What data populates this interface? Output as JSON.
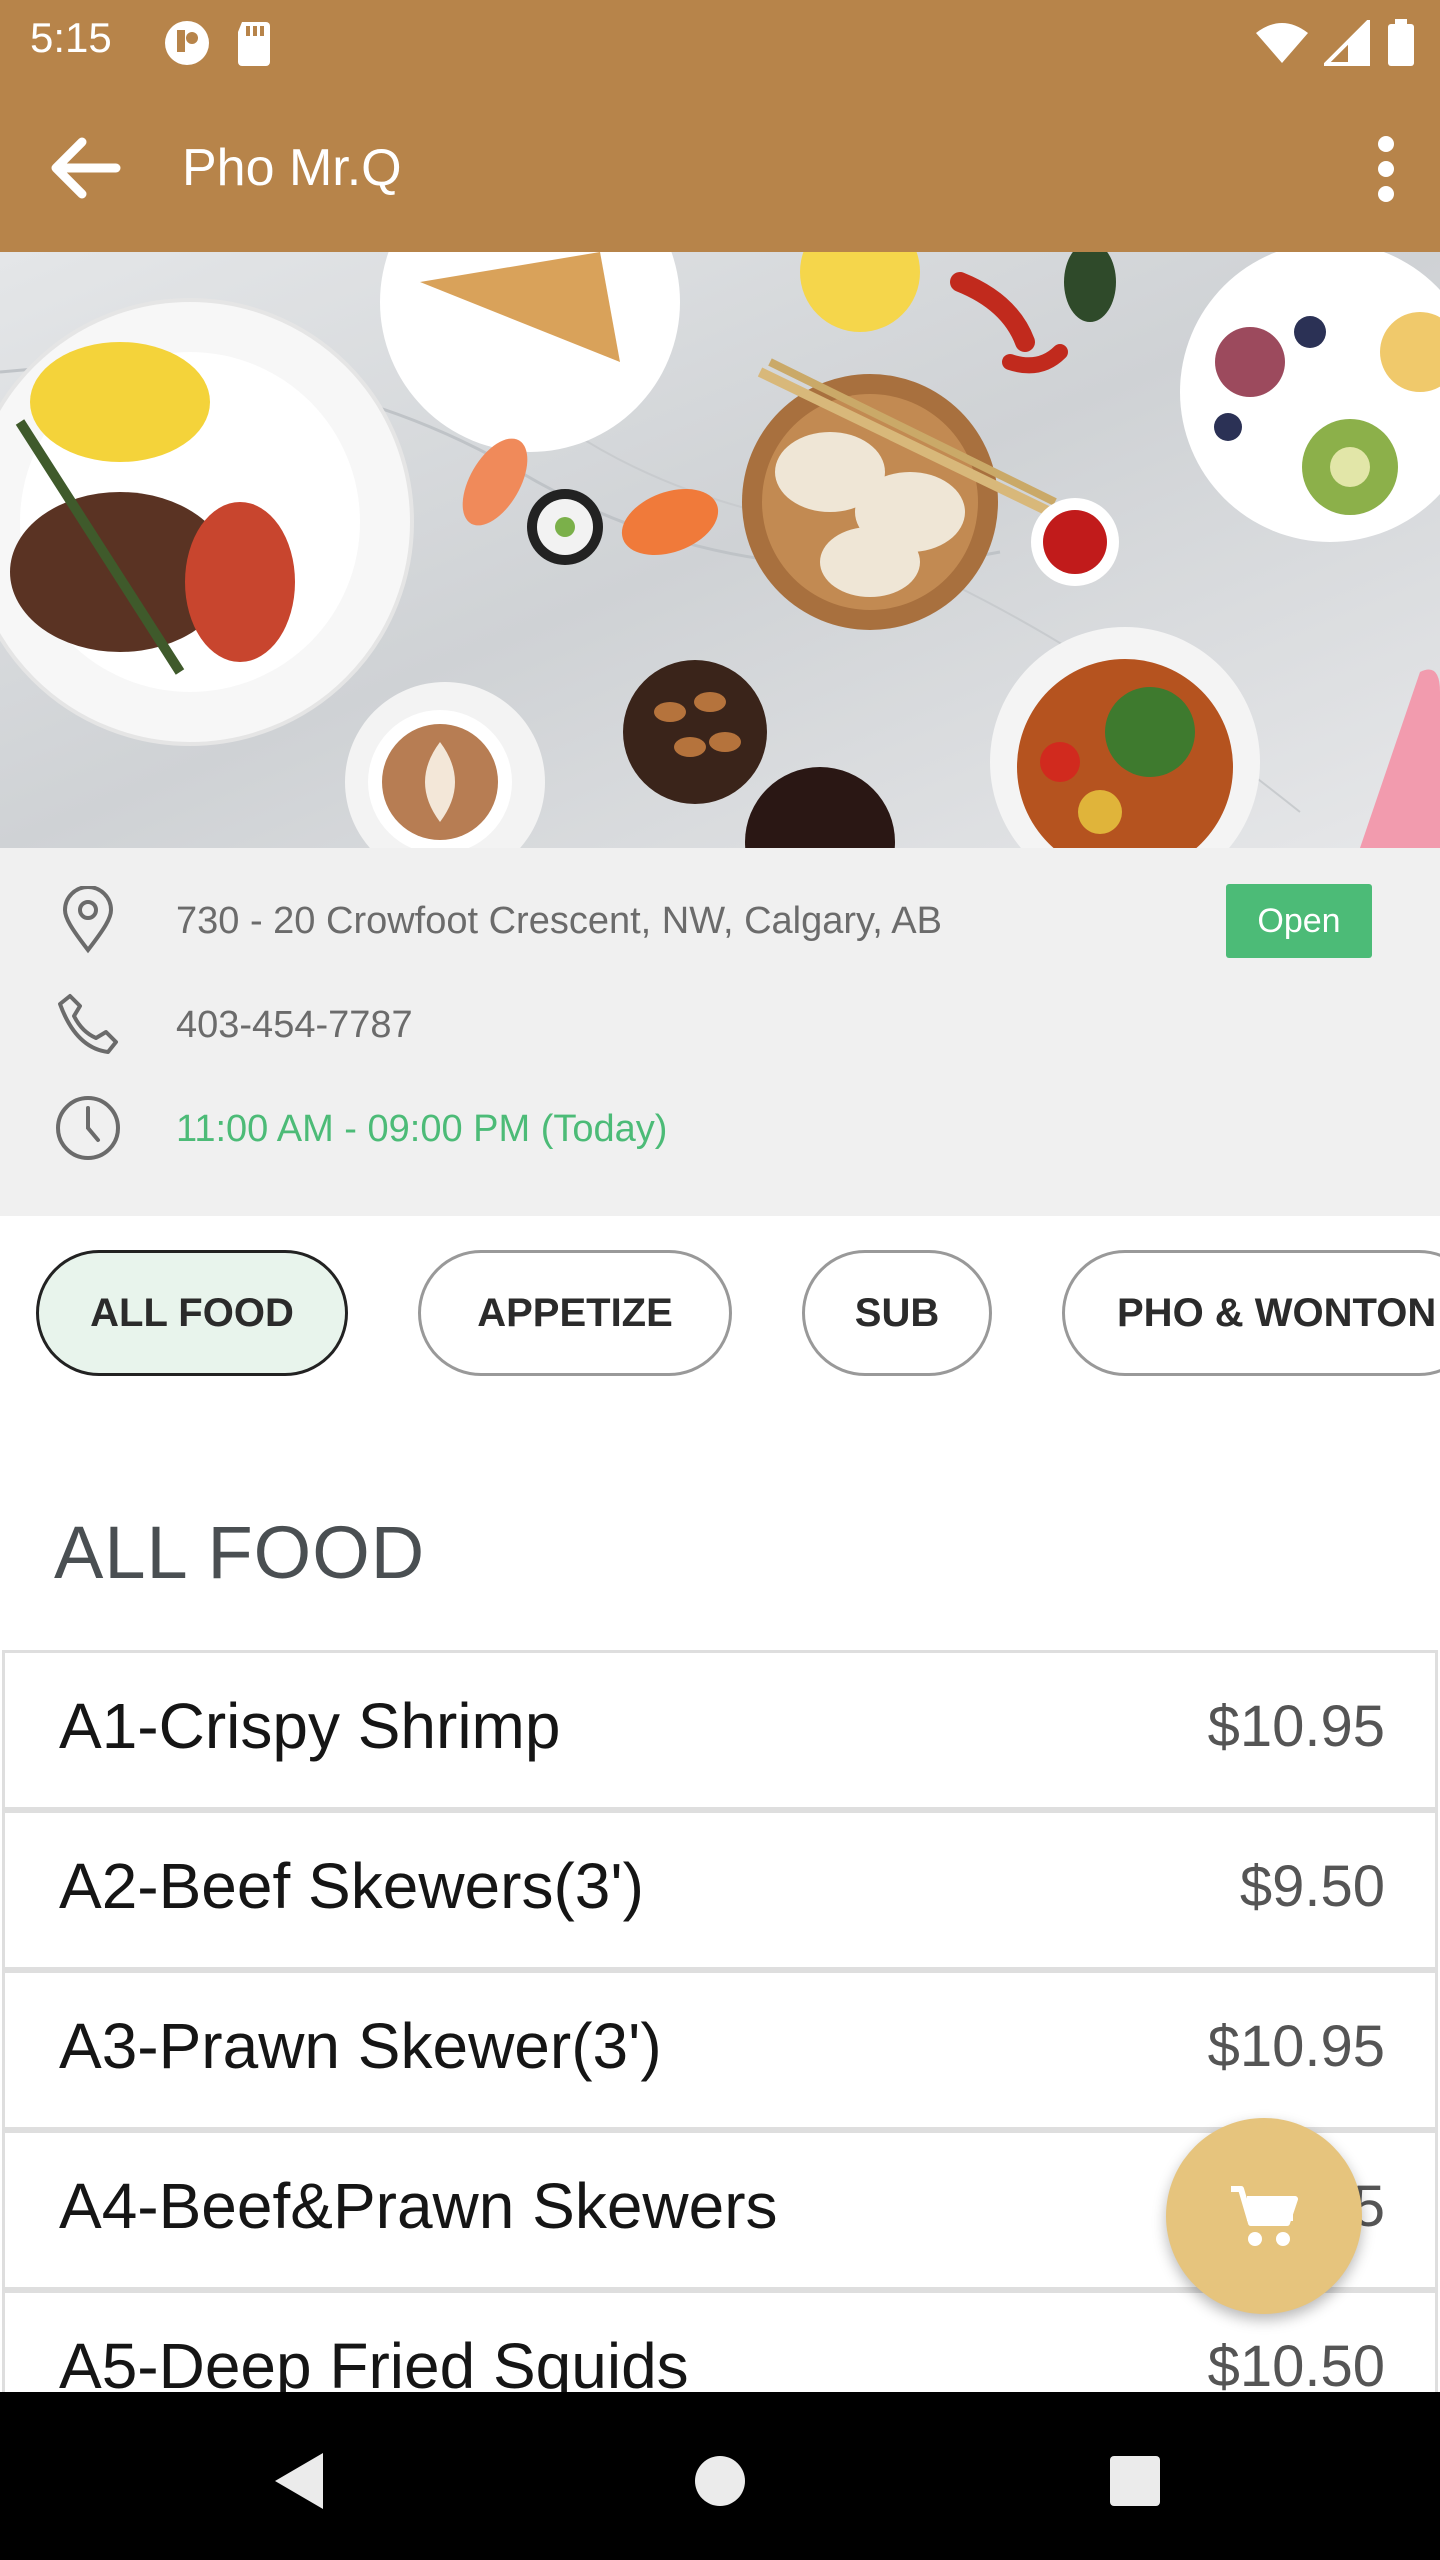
{
  "status": {
    "time": "5:15"
  },
  "header": {
    "title": "Pho Mr.Q"
  },
  "info": {
    "address": "730 - 20 Crowfoot Crescent, NW, Calgary, AB",
    "phone": "403-454-7787",
    "hours": "11:00 AM - 09:00 PM (Today)",
    "status_badge": "Open"
  },
  "categories": [
    {
      "label": "ALL FOOD",
      "active": true
    },
    {
      "label": "APPETIZE"
    },
    {
      "label": "SUB"
    },
    {
      "label": "PHO & WONTON"
    }
  ],
  "section_title": "ALL FOOD",
  "menu": [
    {
      "name": "A1-Crispy Shrimp",
      "price": "$10.95"
    },
    {
      "name": "A2-Beef Skewers(3')",
      "price": "$9.50"
    },
    {
      "name": "A3-Prawn Skewer(3')",
      "price": "$10.95"
    },
    {
      "name": "A4-Beef&Prawn Skewers",
      "price": "$10.95"
    },
    {
      "name": "A5-Deep Fried Squids",
      "price": "$10.50"
    }
  ],
  "colors": {
    "appbar": "#b7844a",
    "accent_green": "#4cbb77",
    "fab": "#e6c47d"
  },
  "icons": {
    "back": "arrow-left-icon",
    "more": "more-vertical-icon",
    "location": "location-pin-icon",
    "phone": "phone-icon",
    "clock": "clock-icon",
    "cart": "shopping-cart-icon"
  }
}
